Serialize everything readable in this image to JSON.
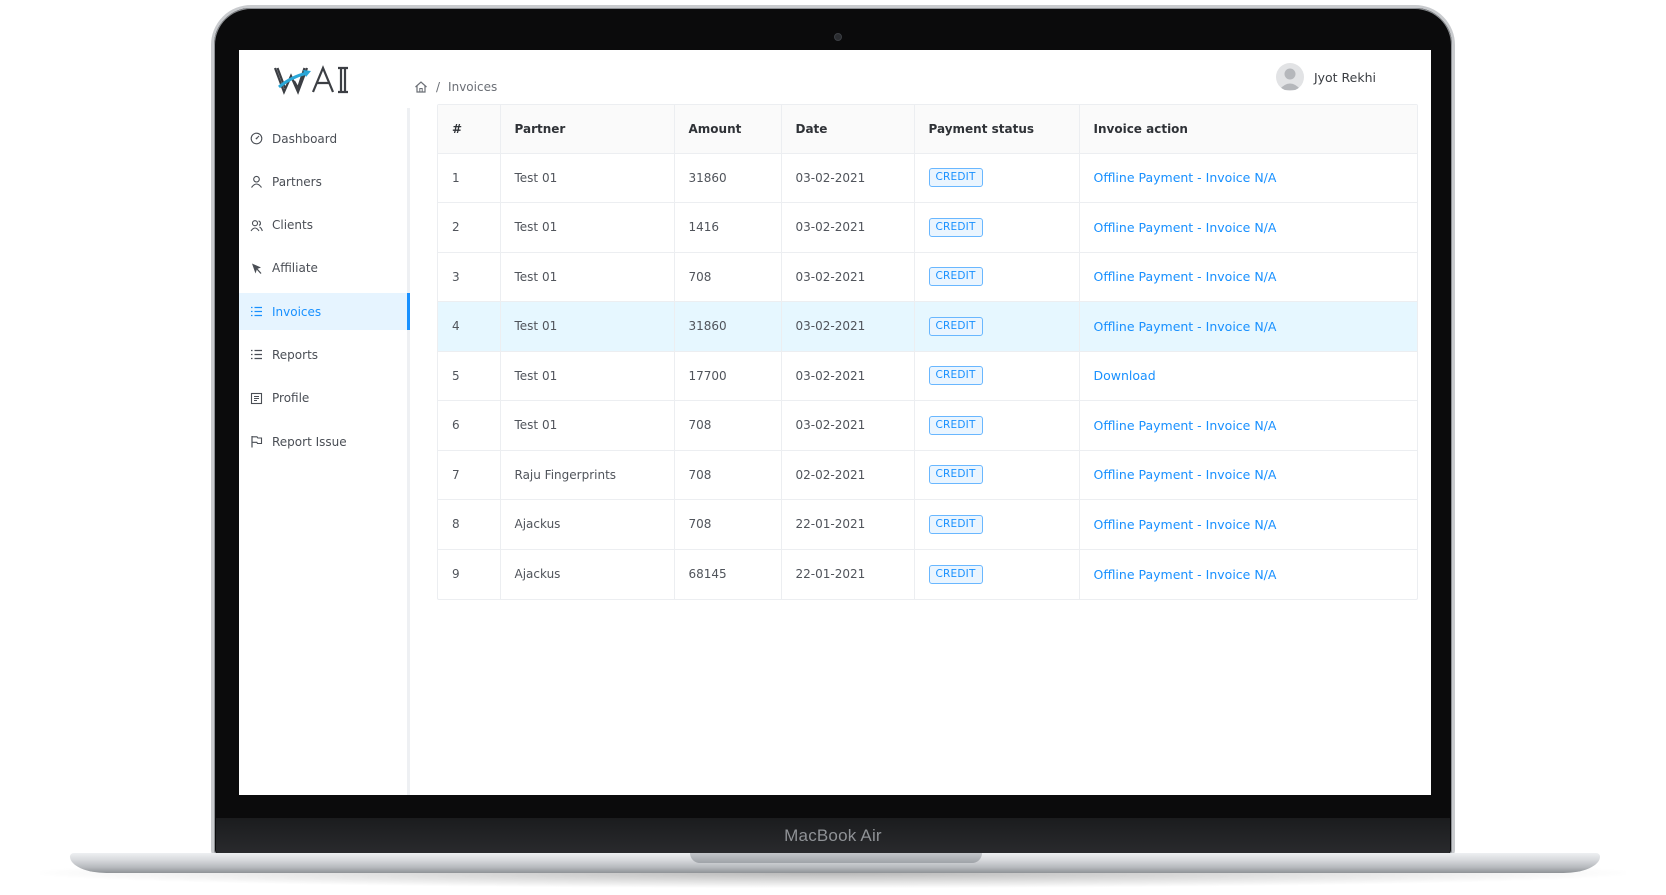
{
  "device": {
    "model_label": "MacBook Air"
  },
  "header": {
    "logo_text": "WAI",
    "breadcrumb": {
      "current": "Invoices",
      "separator": "/"
    },
    "user": {
      "name": "Jyot Rekhi"
    }
  },
  "sidebar": {
    "items": [
      {
        "label": "Dashboard",
        "icon": "dashboard-icon",
        "active": false
      },
      {
        "label": "Partners",
        "icon": "user-icon",
        "active": false
      },
      {
        "label": "Clients",
        "icon": "team-icon",
        "active": false
      },
      {
        "label": "Affiliate",
        "icon": "pointer-icon",
        "active": false
      },
      {
        "label": "Invoices",
        "icon": "list-icon",
        "active": true
      },
      {
        "label": "Reports",
        "icon": "list-icon",
        "active": false
      },
      {
        "label": "Profile",
        "icon": "profile-card-icon",
        "active": false
      },
      {
        "label": "Report Issue",
        "icon": "flag-icon",
        "active": false
      }
    ]
  },
  "table": {
    "columns": [
      "#",
      "Partner",
      "Amount",
      "Date",
      "Payment status",
      "Invoice action"
    ],
    "rows": [
      {
        "num": "1",
        "partner": "Test 01",
        "amount": "31860",
        "date": "03-02-2021",
        "status": "CREDIT",
        "action": "Offline Payment - Invoice N/A"
      },
      {
        "num": "2",
        "partner": "Test 01",
        "amount": "1416",
        "date": "03-02-2021",
        "status": "CREDIT",
        "action": "Offline Payment - Invoice N/A"
      },
      {
        "num": "3",
        "partner": "Test 01",
        "amount": "708",
        "date": "03-02-2021",
        "status": "CREDIT",
        "action": "Offline Payment - Invoice N/A"
      },
      {
        "num": "4",
        "partner": "Test 01",
        "amount": "31860",
        "date": "03-02-2021",
        "status": "CREDIT",
        "action": "Offline Payment - Invoice N/A",
        "highlighted": true
      },
      {
        "num": "5",
        "partner": "Test 01",
        "amount": "17700",
        "date": "03-02-2021",
        "status": "CREDIT",
        "action": "Download"
      },
      {
        "num": "6",
        "partner": "Test 01",
        "amount": "708",
        "date": "03-02-2021",
        "status": "CREDIT",
        "action": "Offline Payment - Invoice N/A"
      },
      {
        "num": "7",
        "partner": "Raju Fingerprints",
        "amount": "708",
        "date": "02-02-2021",
        "status": "CREDIT",
        "action": "Offline Payment - Invoice N/A"
      },
      {
        "num": "8",
        "partner": "Ajackus",
        "amount": "708",
        "date": "22-01-2021",
        "status": "CREDIT",
        "action": "Offline Payment - Invoice N/A"
      },
      {
        "num": "9",
        "partner": "Ajackus",
        "amount": "68145",
        "date": "22-01-2021",
        "status": "CREDIT",
        "action": "Offline Payment - Invoice N/A"
      }
    ]
  },
  "colors": {
    "accent": "#1890ff",
    "active_bg": "#e6f4ff",
    "row_highlight": "#e6f7ff",
    "tag_border": "#69b7ff"
  }
}
